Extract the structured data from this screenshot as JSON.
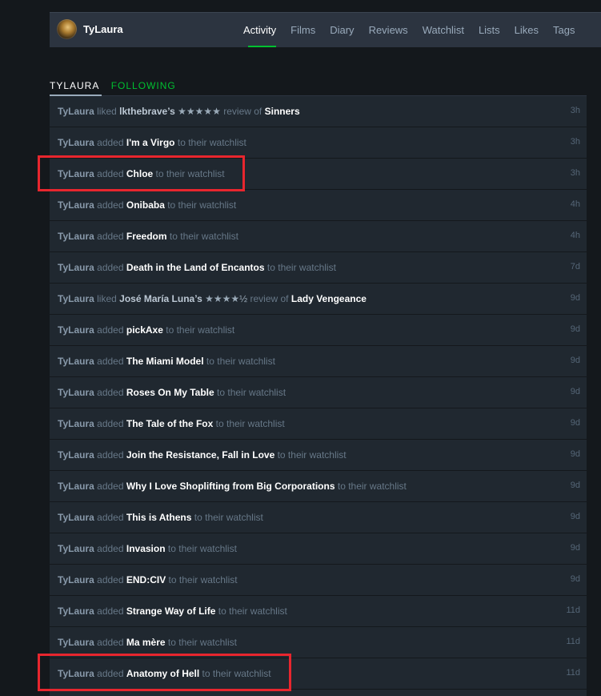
{
  "profile": {
    "username": "TyLaura",
    "nav_tabs": [
      "Activity",
      "Films",
      "Diary",
      "Reviews",
      "Watchlist",
      "Lists",
      "Likes",
      "Tags"
    ],
    "active_tab": "Activity"
  },
  "subnav": {
    "tab_you": "TyLaura",
    "tab_following": "Following"
  },
  "activity": [
    {
      "actor": "TyLaura",
      "verb": "liked",
      "other": "lkthebrave’s",
      "stars": "★★★★★",
      "mid": "review of",
      "film": "Sinners",
      "tail": "",
      "time": "3h"
    },
    {
      "actor": "TyLaura",
      "verb": "added",
      "other": "",
      "stars": "",
      "mid": "",
      "film": "I'm a Virgo",
      "tail": "to their watchlist",
      "time": "3h"
    },
    {
      "actor": "TyLaura",
      "verb": "added",
      "other": "",
      "stars": "",
      "mid": "",
      "film": "Chloe",
      "tail": "to their watchlist",
      "time": "3h"
    },
    {
      "actor": "TyLaura",
      "verb": "added",
      "other": "",
      "stars": "",
      "mid": "",
      "film": "Onibaba",
      "tail": "to their watchlist",
      "time": "4h"
    },
    {
      "actor": "TyLaura",
      "verb": "added",
      "other": "",
      "stars": "",
      "mid": "",
      "film": "Freedom",
      "tail": "to their watchlist",
      "time": "4h"
    },
    {
      "actor": "TyLaura",
      "verb": "added",
      "other": "",
      "stars": "",
      "mid": "",
      "film": "Death in the Land of Encantos",
      "tail": "to their watchlist",
      "time": "7d"
    },
    {
      "actor": "TyLaura",
      "verb": "liked",
      "other": "José María Luna’s",
      "stars": "★★★★½",
      "mid": "review of",
      "film": "Lady Vengeance",
      "tail": "",
      "time": "9d"
    },
    {
      "actor": "TyLaura",
      "verb": "added",
      "other": "",
      "stars": "",
      "mid": "",
      "film": "pickAxe",
      "tail": "to their watchlist",
      "time": "9d"
    },
    {
      "actor": "TyLaura",
      "verb": "added",
      "other": "",
      "stars": "",
      "mid": "",
      "film": "The Miami Model",
      "tail": "to their watchlist",
      "time": "9d"
    },
    {
      "actor": "TyLaura",
      "verb": "added",
      "other": "",
      "stars": "",
      "mid": "",
      "film": "Roses On My Table",
      "tail": "to their watchlist",
      "time": "9d"
    },
    {
      "actor": "TyLaura",
      "verb": "added",
      "other": "",
      "stars": "",
      "mid": "",
      "film": "The Tale of the Fox",
      "tail": "to their watchlist",
      "time": "9d"
    },
    {
      "actor": "TyLaura",
      "verb": "added",
      "other": "",
      "stars": "",
      "mid": "",
      "film": "Join the Resistance, Fall in Love",
      "tail": "to their watchlist",
      "time": "9d"
    },
    {
      "actor": "TyLaura",
      "verb": "added",
      "other": "",
      "stars": "",
      "mid": "",
      "film": "Why I Love Shoplifting from Big Corporations",
      "tail": "to their watchlist",
      "time": "9d"
    },
    {
      "actor": "TyLaura",
      "verb": "added",
      "other": "",
      "stars": "",
      "mid": "",
      "film": "This is Athens",
      "tail": "to their watchlist",
      "time": "9d"
    },
    {
      "actor": "TyLaura",
      "verb": "added",
      "other": "",
      "stars": "",
      "mid": "",
      "film": "Invasion",
      "tail": "to their watchlist",
      "time": "9d"
    },
    {
      "actor": "TyLaura",
      "verb": "added",
      "other": "",
      "stars": "",
      "mid": "",
      "film": "END:CIV",
      "tail": "to their watchlist",
      "time": "9d"
    },
    {
      "actor": "TyLaura",
      "verb": "added",
      "other": "",
      "stars": "",
      "mid": "",
      "film": "Strange Way of Life",
      "tail": "to their watchlist",
      "time": "11d"
    },
    {
      "actor": "TyLaura",
      "verb": "added",
      "other": "",
      "stars": "",
      "mid": "",
      "film": "Ma mère",
      "tail": "to their watchlist",
      "time": "11d"
    },
    {
      "actor": "TyLaura",
      "verb": "added",
      "other": "",
      "stars": "",
      "mid": "",
      "film": "Anatomy of Hell",
      "tail": "to their watchlist",
      "time": "11d"
    },
    {
      "actor": "",
      "verb": "",
      "other": "",
      "stars": "",
      "mid": "",
      "film": "",
      "tail": "",
      "time": ""
    }
  ],
  "colors": {
    "accent": "#00c030",
    "highlight": "#e8262e",
    "row_bg": "#202830",
    "page_bg": "#14181c"
  }
}
